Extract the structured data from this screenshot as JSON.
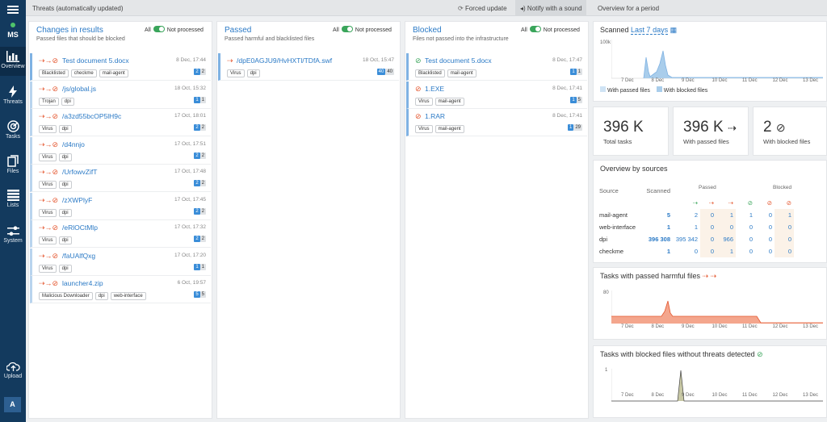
{
  "sidebar": {
    "user_badge": "MS",
    "items": [
      {
        "label": "Overview",
        "icon": "bar-chart-icon"
      },
      {
        "label": "Threats",
        "icon": "lightning-icon"
      },
      {
        "label": "Tasks",
        "icon": "radar-icon"
      },
      {
        "label": "Files",
        "icon": "files-icon"
      },
      {
        "label": "Lists",
        "icon": "list-icon"
      },
      {
        "label": "System",
        "icon": "sliders-icon"
      }
    ],
    "upload_label": "Upload",
    "avatar_letter": "A"
  },
  "topbar": {
    "title": "Threats (automatically updated)",
    "forced_update": "Forced update",
    "notify": "Notify with a sound",
    "overview_period": "Overview for a period"
  },
  "toggle": {
    "all": "All",
    "not_processed": "Not processed"
  },
  "changes": {
    "title": "Changes in results",
    "subtitle": "Passed files that should be blocked",
    "rows": [
      {
        "name": "Test document 5.docx",
        "date": "8 Dec, 17:44",
        "tags": [
          "Blacklisted",
          "checkme",
          "mail-agent"
        ],
        "c1": "2",
        "c2": "2"
      },
      {
        "name": "/js/global.js",
        "date": "18 Oct, 15:32",
        "tags": [
          "Trojan",
          "dpi"
        ],
        "c1": "1",
        "c2": "1"
      },
      {
        "name": "/a3zd55bcOP5lH9c",
        "date": "17 Oct, 18:01",
        "tags": [
          "Virus",
          "dpi"
        ],
        "c1": "2",
        "c2": "2"
      },
      {
        "name": "/d4nnjo",
        "date": "17 Oct, 17:51",
        "tags": [
          "Virus",
          "dpi"
        ],
        "c1": "2",
        "c2": "2"
      },
      {
        "name": "/UrfowvZifT",
        "date": "17 Oct, 17:48",
        "tags": [
          "Virus",
          "dpi"
        ],
        "c1": "2",
        "c2": "2"
      },
      {
        "name": "/zXWPlyF",
        "date": "17 Oct, 17:45",
        "tags": [
          "Virus",
          "dpi"
        ],
        "c1": "2",
        "c2": "2"
      },
      {
        "name": "/eRlOCtMlp",
        "date": "17 Oct, 17:32",
        "tags": [
          "Virus",
          "dpi"
        ],
        "c1": "2",
        "c2": "2"
      },
      {
        "name": "/faUAlfQxg",
        "date": "17 Oct, 17:20",
        "tags": [
          "Virus",
          "dpi"
        ],
        "c1": "1",
        "c2": "1"
      },
      {
        "name": "launcher4.zip",
        "date": "6 Oct, 19:57",
        "tags": [
          "Malicious Downloader",
          "dpi",
          "web-interface"
        ],
        "c1": "5",
        "c2": "5"
      }
    ]
  },
  "passed": {
    "title": "Passed",
    "subtitle": "Passed harmful and blacklisted files",
    "rows": [
      {
        "name": "/dpE0AGJU9/HvHXTl/TDfA.swf",
        "date": "18 Oct, 15:47",
        "tags": [
          "Virus",
          "dpi"
        ],
        "c1": "40",
        "c2": "40"
      }
    ]
  },
  "blocked": {
    "title": "Blocked",
    "subtitle": "Files not passed into the infrastructure",
    "rows": [
      {
        "name": "Test document 5.docx",
        "date": "8 Dec, 17:47",
        "tags": [
          "Blacklisted",
          "mail-agent"
        ],
        "c1": "1",
        "c2": "1"
      },
      {
        "name": "1.EXE",
        "date": "8 Dec, 17:41",
        "tags": [
          "Virus",
          "mail-agent"
        ],
        "c1": "1",
        "c2": "5"
      },
      {
        "name": "1.RAR",
        "date": "8 Dec, 17:41",
        "tags": [
          "Virus",
          "mail-agent"
        ],
        "c1": "1",
        "c2": "29"
      }
    ]
  },
  "scanned": {
    "title": "Scanned",
    "period": "Last 7 days",
    "ymax": "100k",
    "xticks": [
      "7 Dec",
      "8 Dec",
      "9 Dec",
      "10 Dec",
      "11 Dec",
      "12 Dec",
      "13 Dec"
    ],
    "legend_passed": "With passed files",
    "legend_blocked": "With blocked files"
  },
  "stats": [
    {
      "value": "396 K",
      "label": "Total tasks"
    },
    {
      "value": "396 K",
      "label": "With passed files"
    },
    {
      "value": "2",
      "label": "With blocked files"
    }
  ],
  "sources": {
    "title": "Overview by sources",
    "h_source": "Source",
    "h_scanned": "Scanned",
    "h_passed": "Passed",
    "h_blocked": "Blocked",
    "rows": [
      {
        "name": "mail-agent",
        "scanned": "5",
        "vals": [
          "2",
          "0",
          "1",
          "1",
          "0",
          "1"
        ]
      },
      {
        "name": "web-interface",
        "scanned": "1",
        "vals": [
          "1",
          "0",
          "0",
          "0",
          "0",
          "0"
        ]
      },
      {
        "name": "dpi",
        "scanned": "396 308",
        "vals": [
          "395 342",
          "0",
          "966",
          "0",
          "0",
          "0"
        ]
      },
      {
        "name": "checkme",
        "scanned": "1",
        "vals": [
          "0",
          "0",
          "1",
          "0",
          "0",
          "0"
        ]
      }
    ]
  },
  "harmful": {
    "title": "Tasks with passed harmful files",
    "ymax": "80",
    "xticks": [
      "7 Dec",
      "8 Dec",
      "9 Dec",
      "10 Dec",
      "11 Dec",
      "12 Dec",
      "13 Dec"
    ]
  },
  "blocked_chart": {
    "title": "Tasks with blocked files without threats detected",
    "ymax": "1",
    "xticks": [
      "7 Dec",
      "8 Dec",
      "9 Dec",
      "10 Dec",
      "11 Dec",
      "12 Dec",
      "13 Dec"
    ]
  },
  "colors": {
    "accent": "#2b7ac6",
    "sidebar": "#133a5e",
    "passed": "#e4552d",
    "ok": "#3aa55b"
  }
}
